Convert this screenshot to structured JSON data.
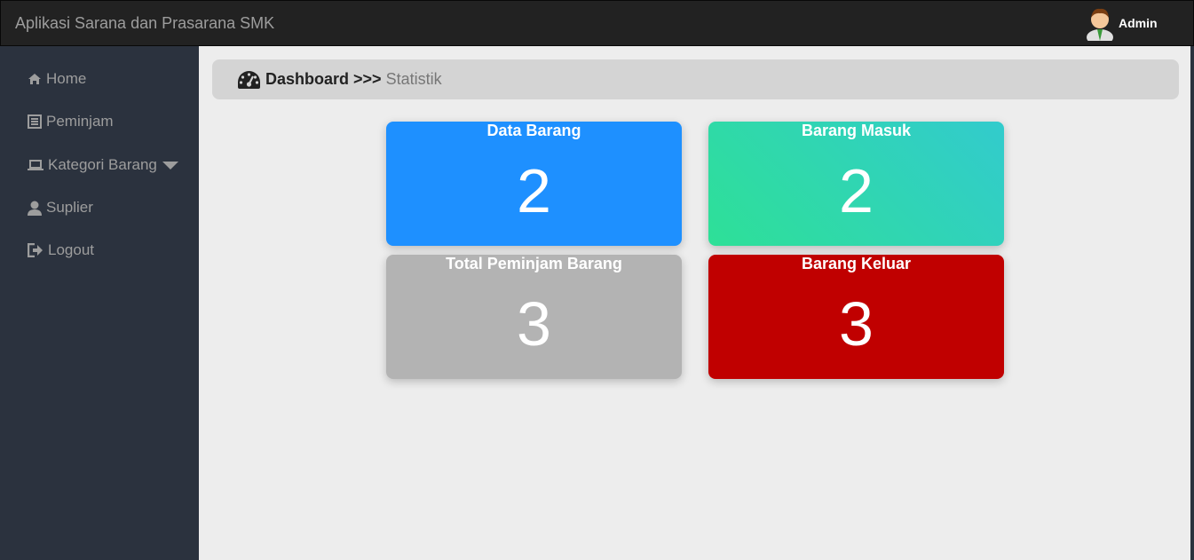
{
  "header": {
    "app_title": "Aplikasi Sarana dan Prasarana SMK",
    "user_name": "Admin",
    "avatar_icon": "user-avatar-icon"
  },
  "sidebar": {
    "items": [
      {
        "label": "Home",
        "icon": "home-icon"
      },
      {
        "label": "Peminjam",
        "icon": "list-icon"
      },
      {
        "label": "Kategori Barang",
        "icon": "laptop-icon",
        "dropdown": true
      },
      {
        "label": "Suplier",
        "icon": "user-icon"
      },
      {
        "label": "Logout",
        "icon": "logout-icon"
      }
    ]
  },
  "breadcrumb": {
    "icon": "dashboard-icon",
    "main": "Dashboard",
    "separator": ">>>",
    "sub": "Statistik"
  },
  "cards": [
    {
      "title": "Data Barang",
      "value": "2",
      "color": "#1e90ff"
    },
    {
      "title": "Barang Masuk",
      "value": "2",
      "color": "#2ed6a8"
    },
    {
      "title": "Total Peminjam Barang",
      "value": "3",
      "color": "#b3b3b3"
    },
    {
      "title": "Barang Keluar",
      "value": "3",
      "color": "#c00000"
    }
  ]
}
